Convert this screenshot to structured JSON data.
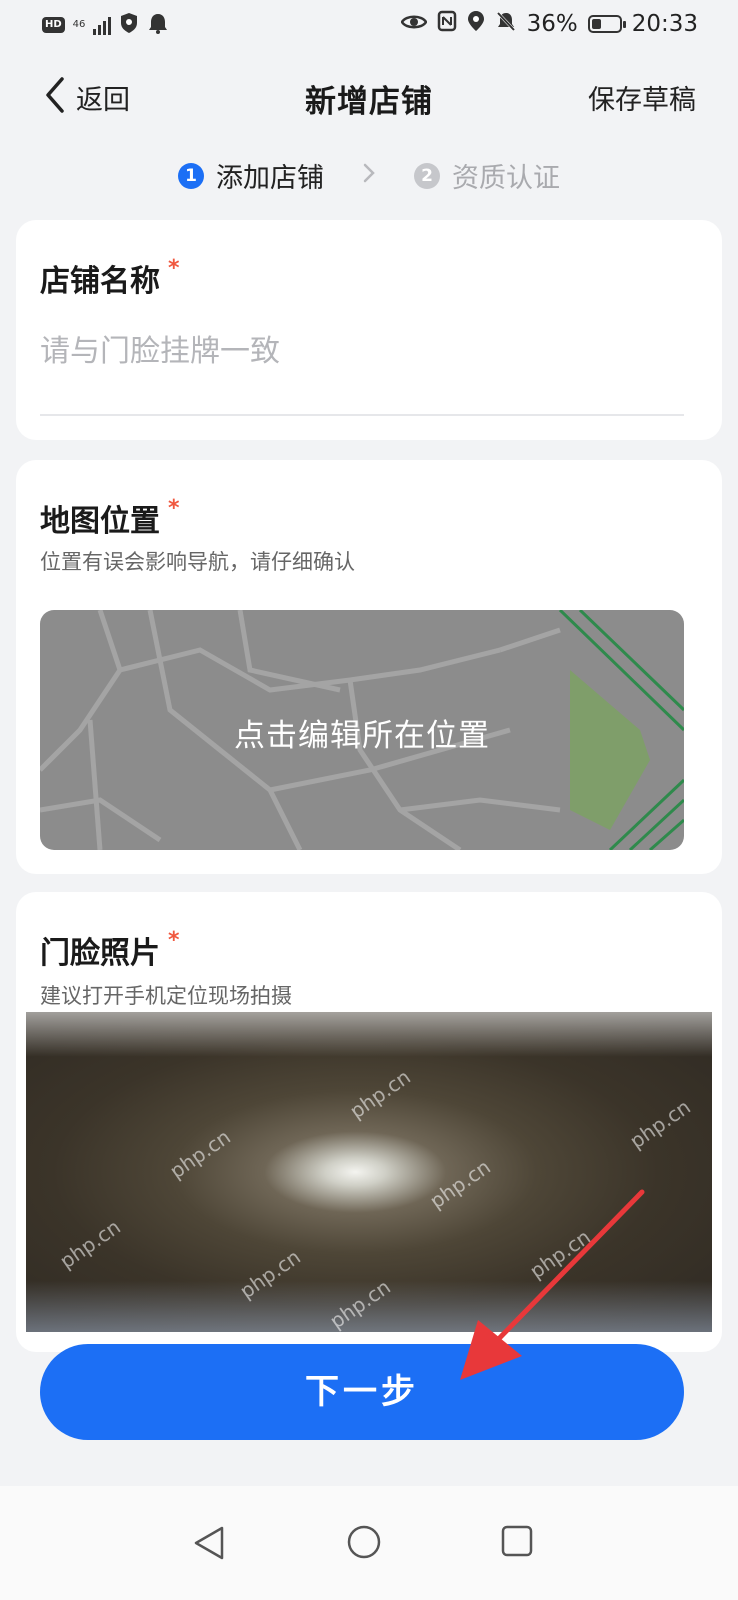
{
  "status_bar": {
    "hd": "HD",
    "network": "46",
    "battery_percent": "36%",
    "battery_level": 0.36,
    "time": "20:33",
    "icons": [
      "shield-icon",
      "notification-icon",
      "eye-icon",
      "nfc-icon",
      "location-icon",
      "mute-icon",
      "battery-icon"
    ]
  },
  "header": {
    "back_label": "返回",
    "title": "新增店铺",
    "save_draft": "保存草稿"
  },
  "steps": [
    {
      "num": "1",
      "label": "添加店铺",
      "active": true
    },
    {
      "num": "2",
      "label": "资质认证",
      "active": false
    }
  ],
  "store_name": {
    "title": "店铺名称",
    "required": "*",
    "placeholder": "请与门脸挂牌一致",
    "value": ""
  },
  "map_location": {
    "title": "地图位置",
    "required": "*",
    "subtitle": "位置有误会影响导航，请仔细确认",
    "map_label": "点击编辑所在位置"
  },
  "storefront_photo": {
    "title": "门脸照片",
    "required": "*",
    "subtitle": "建议打开手机定位现场拍摄",
    "watermark": "php.cn"
  },
  "next_button": "下一步",
  "colors": {
    "primary": "#1c6ff5",
    "required": "#f0583f",
    "background": "#f2f3f5"
  }
}
